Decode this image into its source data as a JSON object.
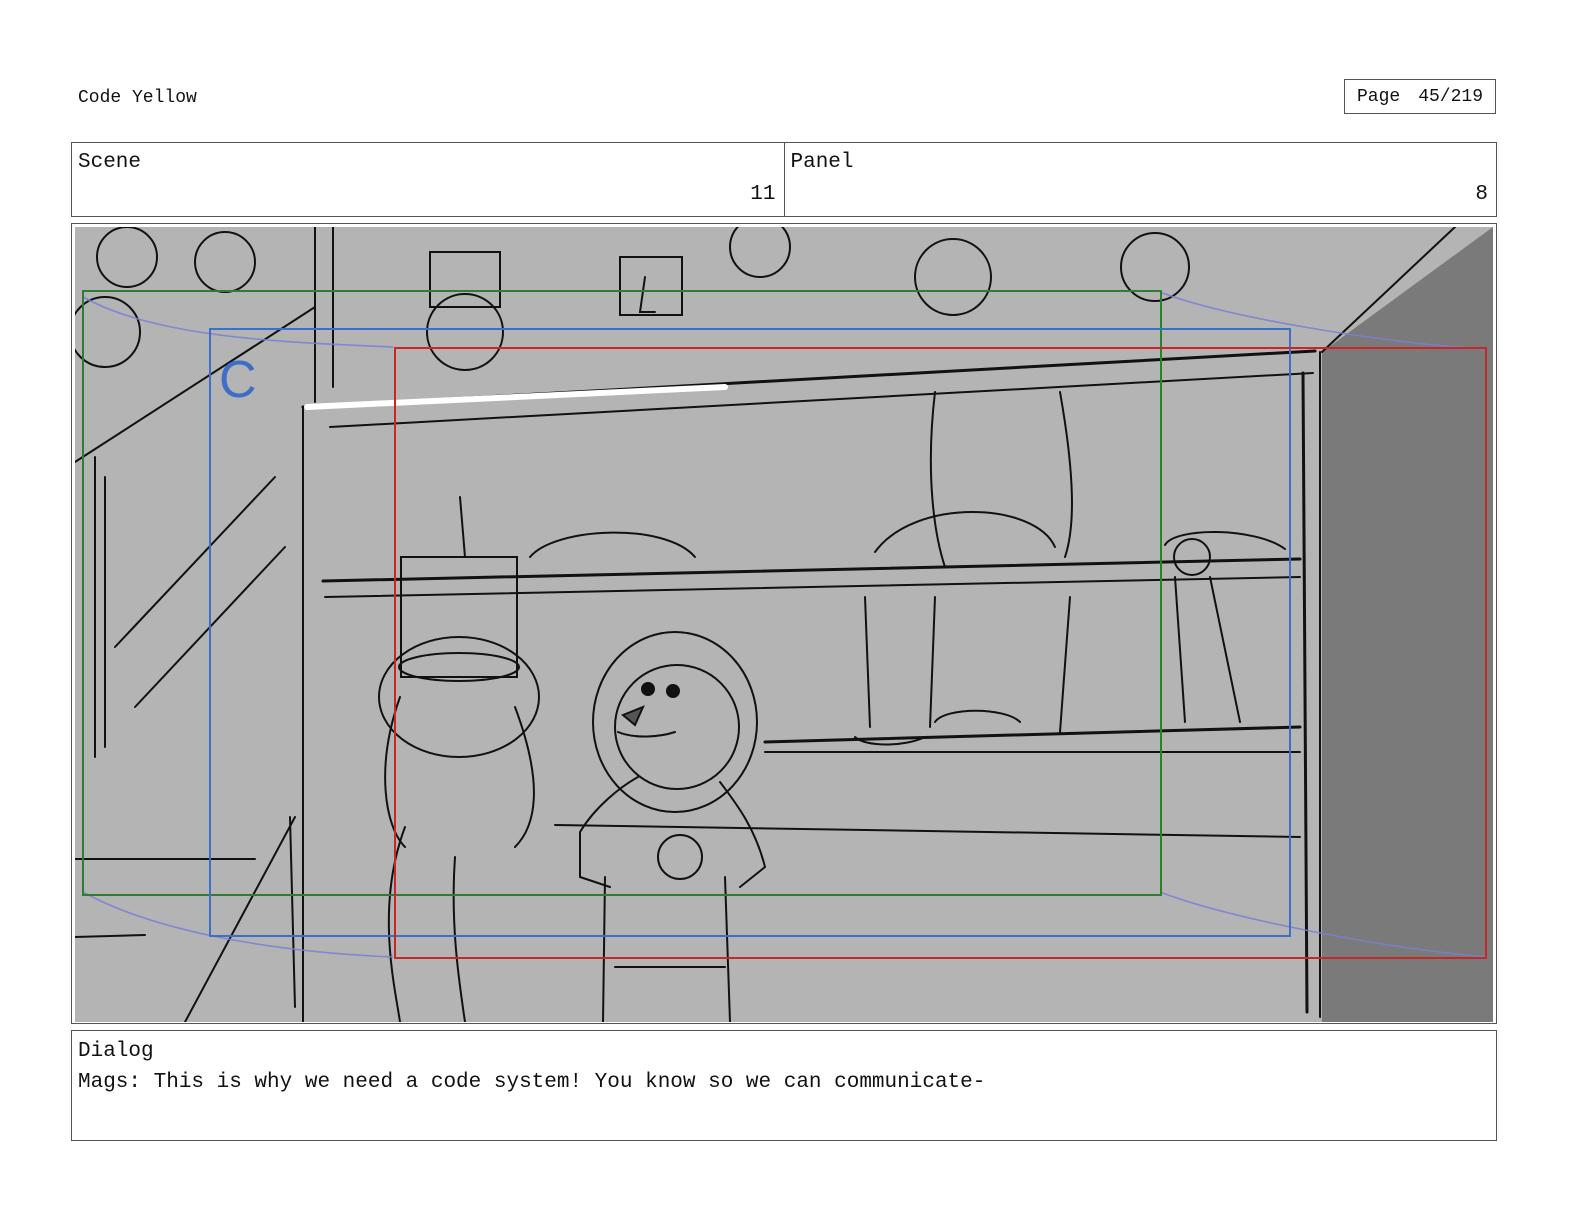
{
  "document": {
    "title": "Code Yellow",
    "page_label": "Page",
    "page_number": "45/219"
  },
  "scene": {
    "label": "Scene",
    "value": "11"
  },
  "panel": {
    "label": "Panel",
    "value": "8"
  },
  "frame": {
    "camera_label": "C",
    "colors": {
      "background": "#b4b4b4",
      "wall": "#7a7a7a",
      "frame_green": "#2e7d32",
      "frame_blue": "#3f6fc4",
      "frame_red": "#c62828"
    }
  },
  "dialog": {
    "label": "Dialog",
    "text": "Mags: This is why we need a code system! You know so we can communicate-"
  }
}
